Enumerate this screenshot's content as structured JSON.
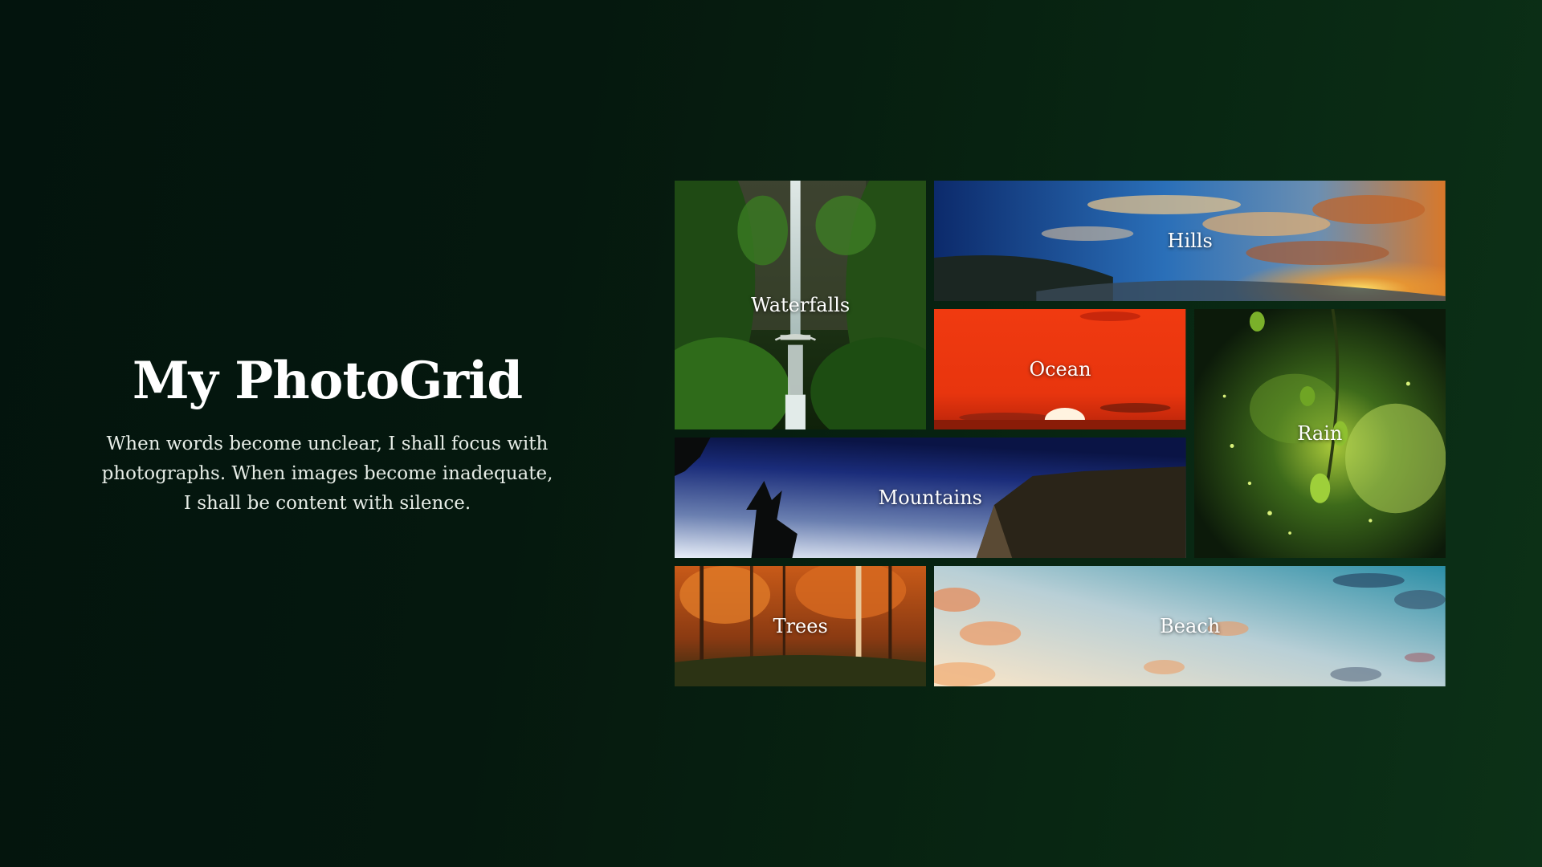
{
  "header": {
    "title": "My PhotoGrid",
    "tagline": "When words become unclear, I shall focus with photographs. When images become inadequate, I shall be content with silence."
  },
  "grid": {
    "tiles": [
      {
        "label": "Waterfalls"
      },
      {
        "label": "Hills"
      },
      {
        "label": "Ocean"
      },
      {
        "label": "Rain"
      },
      {
        "label": "Mountains"
      },
      {
        "label": "Trees"
      },
      {
        "label": "Beach"
      }
    ]
  },
  "colors": {
    "background_dark": "#03140d",
    "background_light": "#0c3117",
    "text": "#ffffff"
  }
}
